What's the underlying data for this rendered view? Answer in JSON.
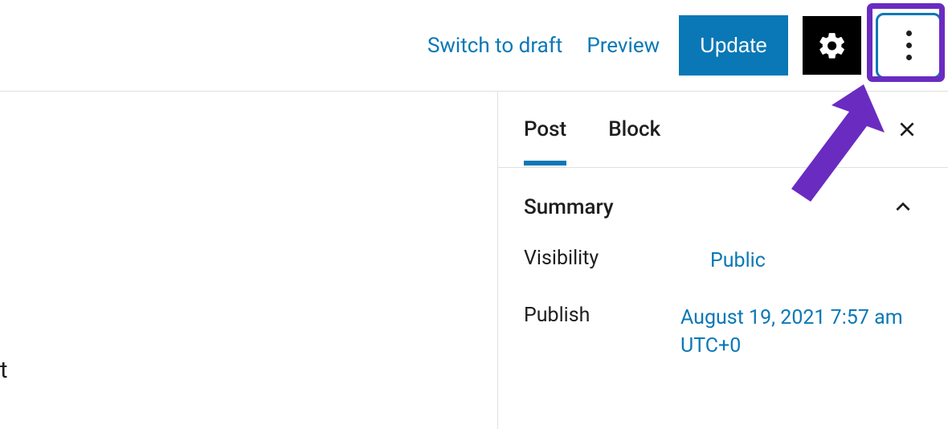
{
  "toolbar": {
    "switch_to_draft": "Switch to draft",
    "preview": "Preview",
    "update": "Update"
  },
  "sidebar": {
    "tabs": {
      "post": "Post",
      "block": "Block"
    },
    "summary": {
      "title": "Summary",
      "visibility": {
        "label": "Visibility",
        "value": "Public"
      },
      "publish": {
        "label": "Publish",
        "value": "August 19, 2021 7:57 am UTC+0"
      }
    }
  },
  "editor": {
    "fragment": "t"
  },
  "colors": {
    "accent": "#0a78b6",
    "annotation": "#6a2bc1"
  }
}
